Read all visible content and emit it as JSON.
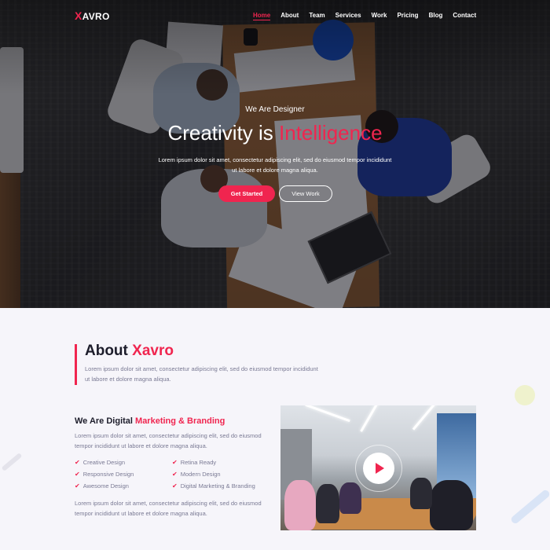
{
  "nav": {
    "logo_x": "X",
    "logo_rest": "AVRO",
    "items": [
      {
        "label": "Home",
        "active": true
      },
      {
        "label": "About",
        "active": false
      },
      {
        "label": "Team",
        "active": false
      },
      {
        "label": "Services",
        "active": false
      },
      {
        "label": "Work",
        "active": false
      },
      {
        "label": "Pricing",
        "active": false
      },
      {
        "label": "Blog",
        "active": false
      },
      {
        "label": "Contact",
        "active": false
      }
    ]
  },
  "hero": {
    "subtitle": "We Are Designer",
    "title_main": "Creativity is ",
    "title_highlight": "Intelligence",
    "description": "Lorem ipsum dolor sit amet, consectetur adipiscing elit, sed do eiusmod tempor incididunt ut labore et dolore magna aliqua.",
    "primary_button": "Get Started",
    "secondary_button": "View Work"
  },
  "about": {
    "title_main": "About ",
    "title_highlight": "Xavro",
    "description": "Lorem ipsum dolor sit amet, consectetur adipiscing elit, sed do eiusmod tempor incididunt ut labore et dolore magna aliqua."
  },
  "digital": {
    "title_main": "We Are Digital ",
    "title_highlight": "Marketing & Branding",
    "description": "Lorem ipsum dolor sit amet, consectetur adipiscing elit, sed do eiusmod tempor incididunt ut labore et dolore magna aliqua.",
    "features_left": [
      "Creative Design",
      "Responsive Design",
      "Awesome Design"
    ],
    "features_right": [
      "Retina Ready",
      "Modern Design",
      "Digital Marketing & Branding"
    ],
    "description2": "Lorem ipsum dolor sit amet, consectetur adipiscing elit, sed do eiusmod tempor incididunt ut labore et dolore magna aliqua."
  },
  "colors": {
    "accent": "#f0254f",
    "text_dark": "#1d1d2b",
    "text_muted": "#7a7a94",
    "page_bg": "#f6f5fa"
  },
  "icons": {
    "check": "check-icon",
    "play": "play-icon"
  }
}
